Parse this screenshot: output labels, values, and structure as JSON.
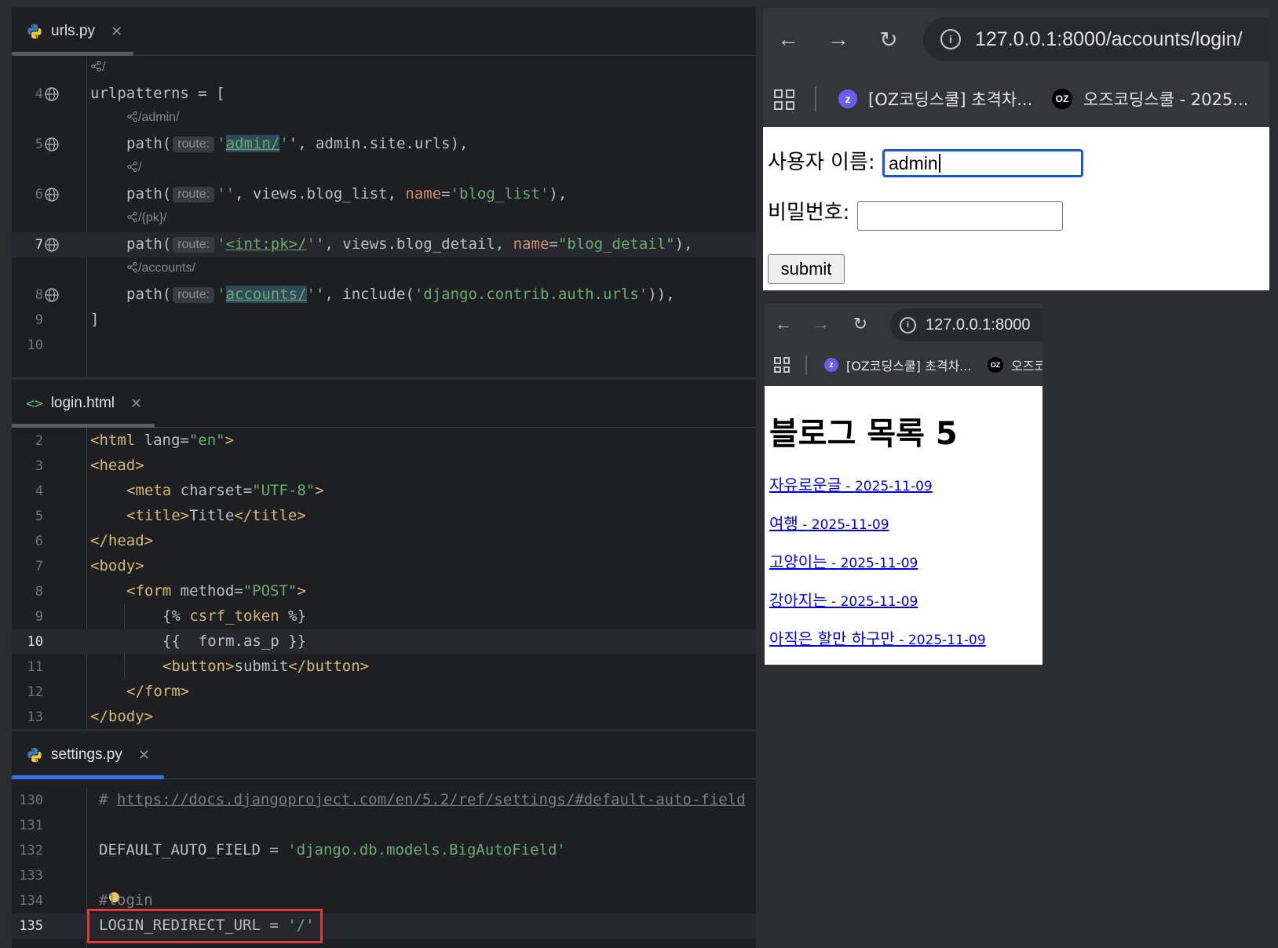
{
  "urls_pane": {
    "tab": "urls.py",
    "lines": [
      {
        "ln": "",
        "hint": "/"
      },
      {
        "ln": "4",
        "code": "urlpatterns = ["
      },
      {
        "ln": "",
        "hint": "/admin/"
      },
      {
        "ln": "5",
        "a": "path(",
        "chip": "route:",
        "b": "'",
        "u": "admin/",
        "c": "', admin.site.urls),"
      },
      {
        "ln": "",
        "hint": "/"
      },
      {
        "ln": "6",
        "a": "path(",
        "chip": "route:",
        "s1": "''",
        "c": ", views.blog_list, ",
        "k": "name",
        "e": "=",
        "s2": "'blog_list'",
        "f": "),"
      },
      {
        "ln": "",
        "hint": "/{pk}/"
      },
      {
        "ln": "7",
        "a": "path(",
        "chip": "route:",
        "b": "'",
        "u": "<int:pk>/",
        "c": "', views.blog_detail, ",
        "k": "name",
        "e": "=",
        "s2": "\"blog_detail\"",
        "f": "),"
      },
      {
        "ln": "",
        "hint": "/accounts/"
      },
      {
        "ln": "8",
        "a": "path(",
        "chip": "route:",
        "b": "'",
        "u": "accounts/",
        "c": "', include(",
        "s2": "'django.contrib.auth.urls'",
        "f": ")),"
      },
      {
        "ln": "9",
        "code": "]"
      },
      {
        "ln": "10",
        "code": ""
      }
    ]
  },
  "login_pane": {
    "tab": "login.html",
    "lines": [
      {
        "ln": "2",
        "t1": "<html ",
        "attr": "lang",
        "eq": "=",
        "val": "\"en\"",
        "t2": ">"
      },
      {
        "ln": "3",
        "t1": "<head>"
      },
      {
        "ln": "4",
        "t1": "<meta ",
        "attr": "charset",
        "eq": "=",
        "val": "\"UTF-8\"",
        "t2": ">"
      },
      {
        "ln": "5",
        "t1": "<title>",
        "plain": "Title",
        "t2": "</title>"
      },
      {
        "ln": "6",
        "t1": "</head>"
      },
      {
        "ln": "7",
        "t1": "<body>"
      },
      {
        "ln": "8",
        "t1": "<form ",
        "attr": "method",
        "eq": "=",
        "val": "\"POST\"",
        "t2": ">"
      },
      {
        "ln": "9",
        "p1": "{% ",
        "t1": "csrf_token",
        "p2": " %}"
      },
      {
        "ln": "10",
        "p1": "{{  form.as_p }}"
      },
      {
        "ln": "11",
        "t1": "<button>",
        "plain": "submit",
        "t2": "</button>"
      },
      {
        "ln": "12",
        "t1": "</form>"
      },
      {
        "ln": "13",
        "t1": "</body>"
      }
    ]
  },
  "settings_pane": {
    "tab": "settings.py",
    "lines": [
      {
        "ln": "130",
        "hash": "# ",
        "link": "https://docs.djangoproject.com/en/5.2/ref/settings/#default-auto-field"
      },
      {
        "ln": "131"
      },
      {
        "ln": "132",
        "name": "DEFAULT_AUTO_FIELD = ",
        "str": "'django.db.models.BigAutoField'"
      },
      {
        "ln": "133"
      },
      {
        "ln": "134",
        "comment": "#login"
      },
      {
        "ln": "135",
        "name": "LOGIN_REDIRECT_URL = ",
        "str": "'/'"
      }
    ]
  },
  "browser_login": {
    "url": "127.0.0.1:8000/accounts/login/",
    "bookmarks": [
      "[OZ코딩스쿨] 초격차...",
      "오즈코딩스쿨 - 2025..."
    ],
    "username_label": "사용자 이름:",
    "username_value": "admin",
    "password_label": "비밀번호:",
    "submit_label": "submit"
  },
  "browser_list": {
    "url": "127.0.0.1:8000",
    "bookmarks": [
      "[OZ코딩스쿨] 초격차...",
      "오즈코"
    ],
    "heading": "블로그 목록 5",
    "posts": [
      {
        "title": "자유로운글",
        "date": "2025-11-09"
      },
      {
        "title": "여행",
        "date": "2025-11-09"
      },
      {
        "title": "고양이는",
        "date": "2025-11-09"
      },
      {
        "title": "강아지는",
        "date": "2025-11-09"
      },
      {
        "title": "아직은 할만 하구만",
        "date": "2025-11-09"
      }
    ],
    "sep": " - "
  }
}
